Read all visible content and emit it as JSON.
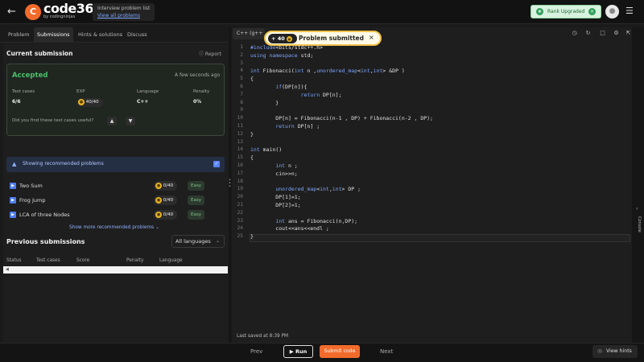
{
  "header": {
    "back_icon": "arrow-left-icon",
    "brand": "code360",
    "brand_sub": "by codingninjas",
    "crumb_title": "Interview problem list",
    "crumb_link": "View all problems",
    "rank_label": "Rank Upgraded",
    "rank_color": "#2f9e58"
  },
  "left_tabs": [
    {
      "label": "Problem"
    },
    {
      "label": "Submissions"
    },
    {
      "label": "Hints & solutions"
    },
    {
      "label": "Discuss"
    }
  ],
  "submission": {
    "heading": "Current submission",
    "report": "Report",
    "status": "Accepted",
    "time": "A few seconds ago",
    "labels": {
      "tests": "Test cases",
      "exp": "EXP",
      "language": "Language",
      "penalty": "Penalty"
    },
    "tests": "6/6",
    "exp": "40/40",
    "language": "C++",
    "penalty": "0%",
    "useful_question": "Did you find these test cases useful?"
  },
  "recommended": {
    "label": "Showing recommended problems",
    "problems": [
      {
        "name": "Two Sum",
        "exp": "0/40",
        "difficulty": "Easy"
      },
      {
        "name": "Frog Jump",
        "exp": "0/40",
        "difficulty": "Easy"
      },
      {
        "name": "LCA of three Nodes",
        "exp": "0/40",
        "difficulty": "Easy"
      }
    ],
    "show_more": "Show more recommended problems"
  },
  "previous": {
    "heading": "Previous submissions",
    "lang_filter": "All languages",
    "columns": [
      "Status",
      "Test cases",
      "Score",
      "Penalty",
      "Language"
    ]
  },
  "editor": {
    "language": "C++ (g++ 5.4)",
    "toast_points": "+ 40",
    "toast_message": "Problem submitted",
    "lines": [
      "#include<bits/stdc++.h>",
      "using namespace std;",
      "",
      "int Fibonacci(int n ,unordered_map<int,int> &DP )",
      "{",
      "        if(DP[n]){",
      "                return DP[n];",
      "        }",
      "",
      "        DP[n] = Fibonacci(n-1 , DP) + Fibonacci(n-2 , DP);",
      "        return DP[n] ;",
      "}",
      "",
      "int main()",
      "{",
      "        int n ;",
      "        cin>>n;",
      "",
      "        unordered_map<int,int> DP ;",
      "        DP[1]=1;",
      "        DP[2]=1;",
      "",
      "        int ans = Fibonacci(n,DP);",
      "        cout<<ans<<endl ;",
      "}"
    ],
    "saved": "Last saved at 8:39 PM",
    "console": "Console"
  },
  "bottom": {
    "prev": "Prev",
    "run": "Run",
    "submit": "Submit code",
    "next": "Next",
    "hints": "View hints"
  }
}
